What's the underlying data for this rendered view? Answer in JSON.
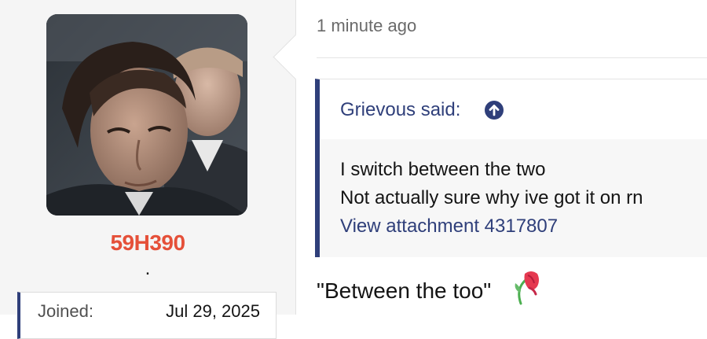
{
  "user": {
    "avatar_icon": "avatar-photo",
    "username": "59H390",
    "title": ".",
    "username_color": "#e55039",
    "extras": [
      {
        "term": "Joined:",
        "value": "Jul 29, 2025"
      }
    ]
  },
  "post": {
    "timestamp": "1 minute ago",
    "quote": {
      "author_label": "Grievous said:",
      "jump_icon": "arrow-up-circle-icon",
      "lines": [
        "I switch between the two",
        "Not actually sure why ive got it on rn"
      ],
      "attachment_link": "View attachment 4317807"
    },
    "reply_text": "\"Between the too\"",
    "reply_emoji": "wilted-flower-icon"
  },
  "colors": {
    "accent": "#2f3f7a",
    "username": "#e55039",
    "sidebar_bg": "#f5f5f5"
  }
}
